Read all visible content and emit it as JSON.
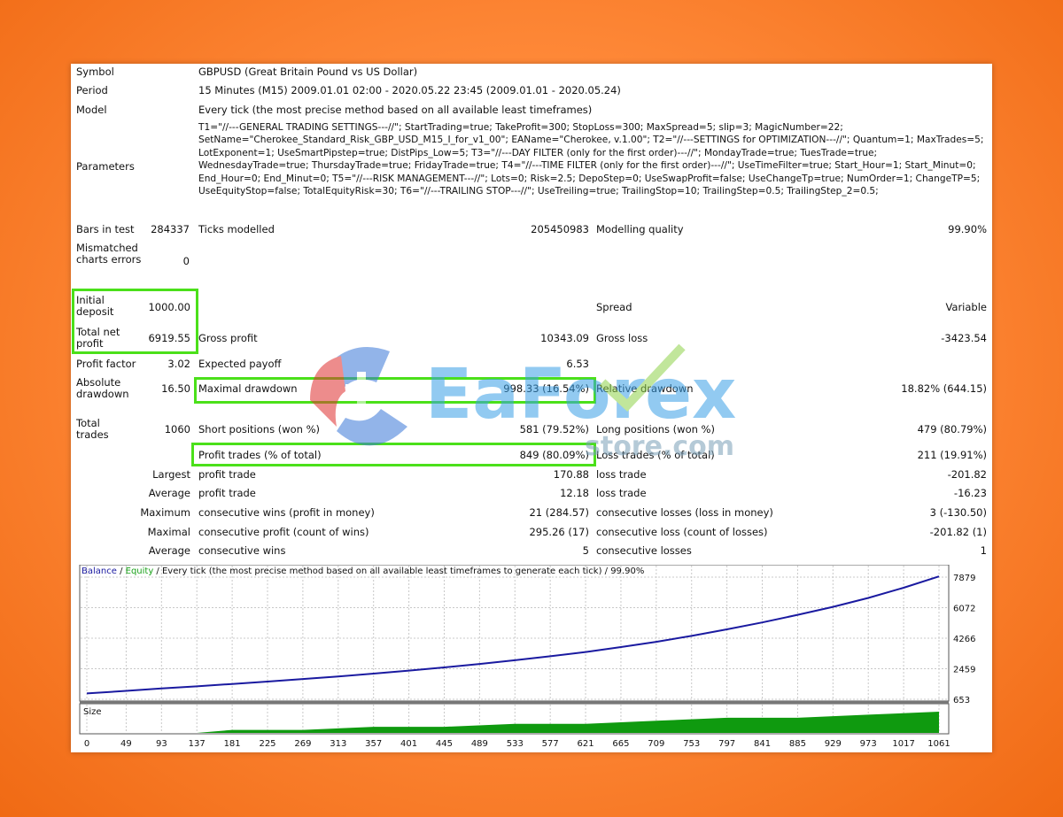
{
  "report": {
    "symbol_label": "Symbol",
    "symbol_value": "GBPUSD (Great Britain Pound vs US Dollar)",
    "period_label": "Period",
    "period_value": "15 Minutes (M15) 2009.01.01 02:00 - 2020.05.22 23:45 (2009.01.01 - 2020.05.24)",
    "model_label": "Model",
    "model_value": "Every tick (the most precise method based on all available least timeframes)",
    "parameters_label": "Parameters",
    "parameters_value": "T1=\"//---GENERAL TRADING SETTINGS---//\"; StartTrading=true; TakeProfit=300; StopLoss=300; MaxSpread=5; slip=3; MagicNumber=22; SetName=\"Cherokee_Standard_Risk_GBP_USD_M15_I_for_v1_00\"; EAName=\"Cherokee, v.1.00\"; T2=\"//---SETTINGS for OPTIMIZATION---//\"; Quantum=1; MaxTrades=5; LotExponent=1; UseSmartPipstep=true; DistPips_Low=5; T3=\"//---DAY FILTER (only for the first order)---//\"; MondayTrade=true; TuesTrade=true; WednesdayTrade=true; ThursdayTrade=true; FridayTrade=true; T4=\"//---TIME FILTER (only for the first order)---//\"; UseTimeFilter=true; Start_Hour=1; Start_Minut=0; End_Hour=0; End_Minut=0; T5=\"//---RISK MANAGEMENT---//\"; Lots=0; Risk=2.5; DepoStep=0; UseSwapProfit=false; UseChangeTp=true; NumOrder=1; ChangeTP=5; UseEquityStop=false; TotalEquityRisk=30; T6=\"//---TRAILING STOP---//\"; UseTreiling=true; TrailingStop=10; TrailingStep=0.5; TrailingStep_2=0.5;",
    "bars_label": "Bars in test",
    "bars_value": "284337",
    "ticks_label": "Ticks modelled",
    "ticks_value": "205450983",
    "quality_label": "Modelling quality",
    "quality_value": "99.90%",
    "mismatched_label": "Mismatched charts errors",
    "mismatched_value": "0",
    "initial_label": "Initial deposit",
    "initial_value": "1000.00",
    "spread_label": "Spread",
    "spread_value": "Variable",
    "netprofit_label": "Total net profit",
    "netprofit_value": "6919.55",
    "grossprofit_label": "Gross profit",
    "grossprofit_value": "10343.09",
    "grossloss_label": "Gross loss",
    "grossloss_value": "-3423.54",
    "pf_label": "Profit factor",
    "pf_value": "3.02",
    "payoff_label": "Expected payoff",
    "payoff_value": "6.53",
    "absdd_label": "Absolute drawdown",
    "absdd_value": "16.50",
    "maxdd_label": "Maximal drawdown",
    "maxdd_value": "998.33 (16.54%)",
    "reldd_label": "Relative drawdown",
    "reldd_value": "18.82% (644.15)",
    "totaltrades_label": "Total trades",
    "totaltrades_value": "1060",
    "short_label": "Short positions (won %)",
    "short_value": "581 (79.52%)",
    "long_label": "Long positions (won %)",
    "long_value": "479 (80.79%)",
    "profittrades_label": "Profit trades (% of total)",
    "profittrades_value": "849 (80.09%)",
    "losstrades_label": "Loss trades (% of total)",
    "losstrades_value": "211 (19.91%)",
    "largest_label": "Largest",
    "largest_profit_label": "profit trade",
    "largest_profit_value": "170.88",
    "largest_loss_label": "loss trade",
    "largest_loss_value": "-201.82",
    "average_label": "Average",
    "average_profit_label": "profit trade",
    "average_profit_value": "12.18",
    "average_loss_label": "loss trade",
    "average_loss_value": "-16.23",
    "maximum_label": "Maximum",
    "maximum_wins_label": "consecutive wins (profit in money)",
    "maximum_wins_value": "21 (284.57)",
    "maximum_losses_label": "consecutive losses (loss in money)",
    "maximum_losses_value": "3 (-130.50)",
    "maximal_label": "Maximal",
    "maximal_profit_label": "consecutive profit (count of wins)",
    "maximal_profit_value": "295.26 (17)",
    "maximal_loss_label": "consecutive loss (count of losses)",
    "maximal_loss_value": "-201.82 (1)",
    "avgcons_label": "Average",
    "avgcons_wins_label": "consecutive wins",
    "avgcons_wins_value": "5",
    "avgcons_losses_label": "consecutive losses",
    "avgcons_losses_value": "1"
  },
  "watermark": {
    "brand": "EaForex",
    "sub": "store.com"
  },
  "colors": {
    "highlight": "#4be01a",
    "balance": "#1a1aa0",
    "equity": "#18a018",
    "size_bars": "#0f9a0f",
    "grid": "#c8c8c8"
  },
  "chart_data": {
    "type": "line",
    "title_balance": "Balance",
    "title_sep": " / ",
    "title_equity": "Equity",
    "title_rest": " / Every tick (the most precise method based on all available least timeframes to generate each tick) / 99.90%",
    "y_ticks": [
      7879,
      6072,
      4266,
      2459,
      653
    ],
    "ylim": [
      653,
      7879
    ],
    "x_ticks": [
      0,
      49,
      93,
      137,
      181,
      225,
      269,
      313,
      357,
      401,
      445,
      489,
      533,
      577,
      621,
      665,
      709,
      753,
      797,
      841,
      885,
      929,
      973,
      1017,
      1061
    ],
    "xlim": [
      0,
      1061
    ],
    "series": [
      {
        "name": "Balance",
        "x": [
          0,
          49,
          93,
          137,
          181,
          225,
          269,
          313,
          357,
          401,
          445,
          489,
          533,
          577,
          621,
          665,
          709,
          753,
          797,
          841,
          885,
          929,
          973,
          1017,
          1061
        ],
        "values": [
          1000,
          1150,
          1290,
          1420,
          1560,
          1700,
          1850,
          2000,
          2170,
          2350,
          2540,
          2740,
          2960,
          3200,
          3450,
          3740,
          4050,
          4400,
          4790,
          5200,
          5650,
          6120,
          6650,
          7250,
          7919
        ]
      }
    ],
    "size_label": "Size",
    "size_series": {
      "x": [
        0,
        137,
        181,
        269,
        357,
        445,
        533,
        621,
        709,
        797,
        885,
        973,
        1061
      ],
      "values": [
        0,
        0,
        1,
        1,
        2,
        2,
        3,
        3,
        4,
        5,
        5,
        6,
        7
      ]
    }
  }
}
